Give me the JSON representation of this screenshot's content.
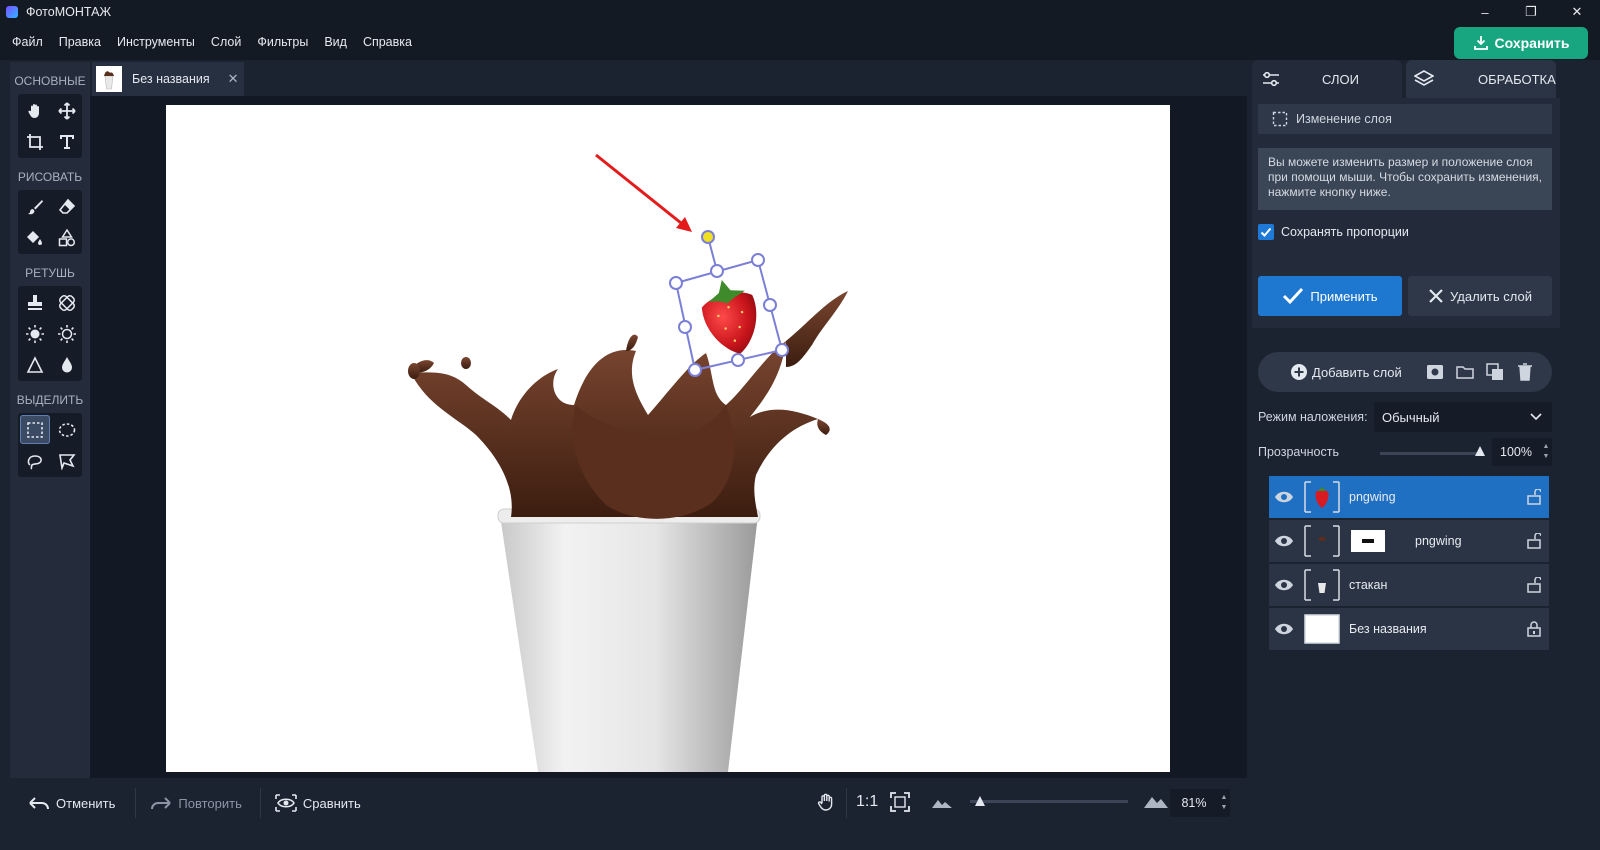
{
  "window": {
    "title": "ФотоМОНТАЖ",
    "controls": {
      "minimize": "–",
      "maximize": "❐",
      "close": "✕"
    }
  },
  "menu": [
    "Файл",
    "Правка",
    "Инструменты",
    "Слой",
    "Фильтры",
    "Вид",
    "Справка"
  ],
  "save_button": "Сохранить",
  "toolbar": {
    "groups": [
      {
        "label": "ОСНОВНЫЕ",
        "tools": [
          "hand-icon",
          "move-icon",
          "crop-icon",
          "text-icon"
        ]
      },
      {
        "label": "РИСОВАТЬ",
        "tools": [
          "brush-icon",
          "eraser-icon",
          "fill-icon",
          "shapes-icon"
        ]
      },
      {
        "label": "РЕТУШЬ",
        "tools": [
          "stamp-icon",
          "patch-icon",
          "brightness-icon",
          "saturation-icon",
          "sharpen-icon",
          "blur-icon"
        ]
      },
      {
        "label": "ВЫДЕЛИТЬ",
        "tools": [
          "rect-select-icon",
          "ellipse-select-icon",
          "lasso-icon",
          "polygon-lasso-icon"
        ]
      }
    ],
    "active_tool": "rect-select-icon"
  },
  "document_tab": {
    "name": "Без названия",
    "close": "✕"
  },
  "bottom_bar": {
    "undo": "Отменить",
    "redo": "Повторить",
    "compare": "Сравнить",
    "actual_size": "1:1",
    "zoom": "81%"
  },
  "right_panel": {
    "tabs": {
      "layers": "СЛОИ",
      "processing": "ОБРАБОТКА"
    },
    "layer_change": "Изменение слоя",
    "hint": "Вы можете изменить размер и положение слоя при помощи мыши. Чтобы сохранить изменения, нажмите кнопку ниже.",
    "keep_proportions": "Сохранять пропорции",
    "apply": "Применить",
    "delete_layer": "Удалить слой",
    "add_layer": "Добавить слой",
    "blend_mode_label": "Режим наложения:",
    "blend_mode_value": "Обычный",
    "opacity_label": "Прозрачность",
    "opacity_value": "100%",
    "opacity_percent": 100,
    "layers": [
      {
        "name": "pngwing",
        "selected": true,
        "locked": false,
        "thumb": "strawberry"
      },
      {
        "name": "pngwing",
        "selected": false,
        "locked": false,
        "thumb": "splash",
        "mask": true
      },
      {
        "name": "стакан",
        "selected": false,
        "locked": false,
        "thumb": "cup"
      },
      {
        "name": "Без названия",
        "selected": false,
        "locked": true,
        "thumb": "white"
      }
    ]
  },
  "colors": {
    "accent_save": "#17a680",
    "accent_apply": "#1f78cf",
    "selected_layer": "#1f6fc2",
    "chocolate": "#5a2f1d",
    "handle_rotate": "#f0e021"
  }
}
